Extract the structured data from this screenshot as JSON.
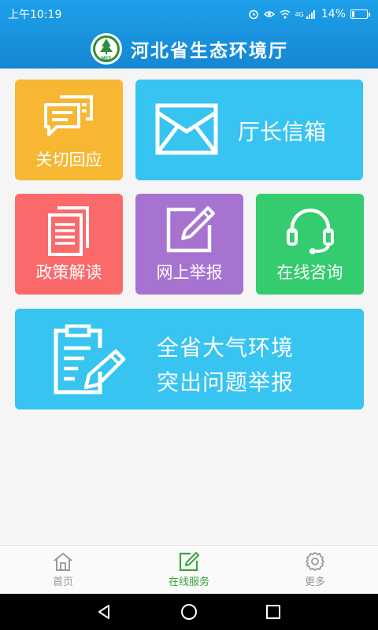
{
  "status_bar": {
    "time": "上午10:19",
    "network": "4G",
    "battery_percent": "14%",
    "battery_level": 0.14,
    "icons": [
      "alarm-icon",
      "eye-icon",
      "wifi-icon",
      "signal-icon",
      "battery-icon"
    ]
  },
  "header": {
    "title": "河北省生态环境厅",
    "logo_text": "MEE"
  },
  "tiles": {
    "reply": {
      "label": "关切回应",
      "color": "#f7b733",
      "icon": "chat-icon"
    },
    "mailbox": {
      "label": "厅长信箱",
      "color": "#38c4f0",
      "icon": "envelope-icon"
    },
    "policy": {
      "label": "政策解读",
      "color": "#fa6a6b",
      "icon": "document-icon"
    },
    "report": {
      "label": "网上举报",
      "color": "#a773d1",
      "icon": "edit-icon"
    },
    "consult": {
      "label": "在线咨询",
      "color": "#34cc6e",
      "icon": "headset-icon"
    },
    "air": {
      "line1": "全省大气环境",
      "line2": "突出问题举报",
      "color": "#38c4f0",
      "icon": "clipboard-icon"
    }
  },
  "tab_bar": {
    "items": [
      {
        "label": "首页",
        "icon": "home-icon",
        "active": false
      },
      {
        "label": "在线服务",
        "icon": "service-edit-icon",
        "active": true
      },
      {
        "label": "更多",
        "icon": "gear-icon",
        "active": false
      }
    ],
    "active_color": "#3aa43a",
    "inactive_color": "#999999"
  },
  "nav_bar": {
    "buttons": [
      "back-icon",
      "home-circle-icon",
      "recents-icon"
    ]
  }
}
